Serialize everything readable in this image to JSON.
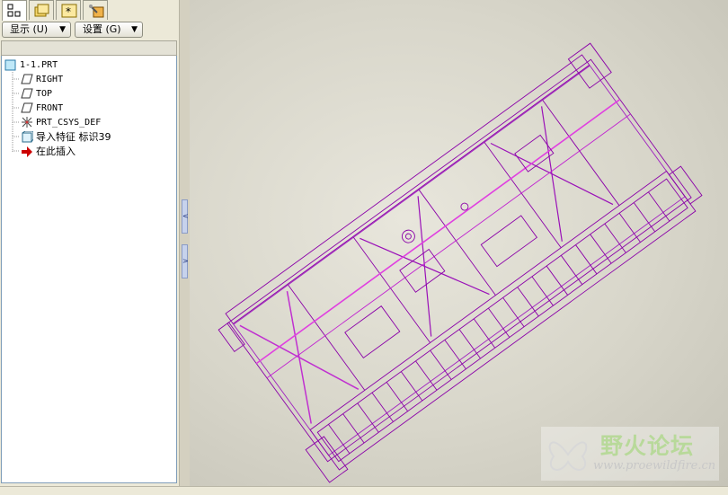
{
  "tabs": [
    {
      "icon": "model-tree-icon",
      "active": true
    },
    {
      "icon": "folder-browser-icon",
      "active": false
    },
    {
      "icon": "favorites-icon",
      "active": false
    },
    {
      "icon": "connections-icon",
      "active": false
    }
  ],
  "toolbar": {
    "show_label": "显示 (U)",
    "settings_label": "设置 (G)"
  },
  "tree": {
    "root": "1-1.PRT",
    "items": [
      {
        "label": "RIGHT",
        "icon": "datum-plane-icon"
      },
      {
        "label": "TOP",
        "icon": "datum-plane-icon"
      },
      {
        "label": "FRONT",
        "icon": "datum-plane-icon"
      },
      {
        "label": "PRT_CSYS_DEF",
        "icon": "coordinate-system-icon"
      },
      {
        "label": "导入特征 标识39",
        "icon": "import-feature-icon"
      },
      {
        "label": "在此插入",
        "icon": "insert-here-arrow-icon"
      }
    ]
  },
  "watermark": {
    "title": "野火论坛",
    "url": "www.proewildfire.cn"
  },
  "colors": {
    "wireframe_primary": "#8a00a8",
    "wireframe_highlight": "#e040e0",
    "insert_arrow": "#cc0000"
  }
}
